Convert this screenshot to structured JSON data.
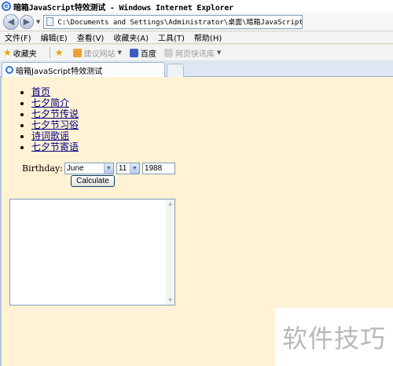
{
  "window": {
    "title": "暗箱JavaScript特效测试 - Windows Internet Explorer"
  },
  "address_bar": {
    "url": "C:\\Documents and Settings\\Administrator\\桌面\\暗箱JavaScript特效测试.html"
  },
  "menu": {
    "items": [
      "文件(F)",
      "编辑(E)",
      "查看(V)",
      "收藏夹(A)",
      "工具(T)",
      "帮助(H)"
    ]
  },
  "favorites_bar": {
    "favorites_label": "收藏夹",
    "suggested_sites": "建议网站",
    "baidu": "百度",
    "web_slice": "网页快讯库"
  },
  "tab": {
    "label": "暗箱JavaScript特效测试"
  },
  "page": {
    "nav_links": [
      "首页",
      "七夕简介",
      "七夕节传说",
      "七夕节习俗",
      "诗词歌谣",
      "七夕节寄语"
    ],
    "birthday_label": "Birthday:",
    "month_value": "June",
    "day_value": "11",
    "year_value": "1988",
    "calculate_label": "Calculate"
  },
  "watermark": {
    "text": "软件技巧"
  }
}
